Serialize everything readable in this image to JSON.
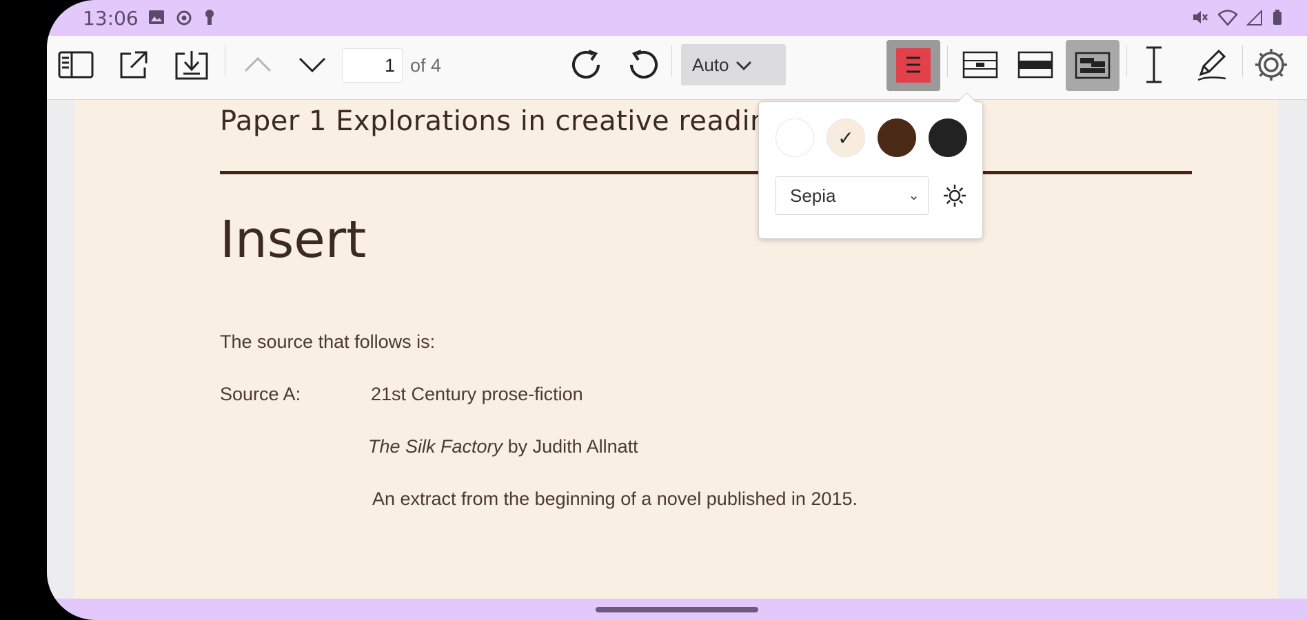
{
  "status_bar": {
    "time": "13:06",
    "left_icons": [
      "image-icon",
      "camera-icon",
      "lock-icon"
    ],
    "right_icons": [
      "mute-icon",
      "wifi-icon",
      "signal-icon",
      "battery-icon"
    ]
  },
  "toolbar": {
    "page_number": "1",
    "page_of": "of 4",
    "zoom_value": "Auto"
  },
  "document": {
    "header": "Paper 1  Explorations in creative reading",
    "title": "Insert",
    "intro": "The source that follows is:",
    "source_label": "Source A:",
    "source_type": "21st Century prose-fiction",
    "book_title": "The Silk Factory",
    "book_author": " by Judith Allnatt",
    "extract_note": "An extract from the beginning of a novel published in 2015."
  },
  "theme_popup": {
    "swatches": [
      "#ffffff",
      "#f8ecde",
      "#4a2a16",
      "#222222"
    ],
    "selected_swatch": 1,
    "check_glyph": "✓",
    "theme_select_value": "Sepia"
  },
  "colors": {
    "status_bar_bg": "#e3c8fb",
    "page_bg": "#f9efe3",
    "accent_active": "#e2404a"
  }
}
